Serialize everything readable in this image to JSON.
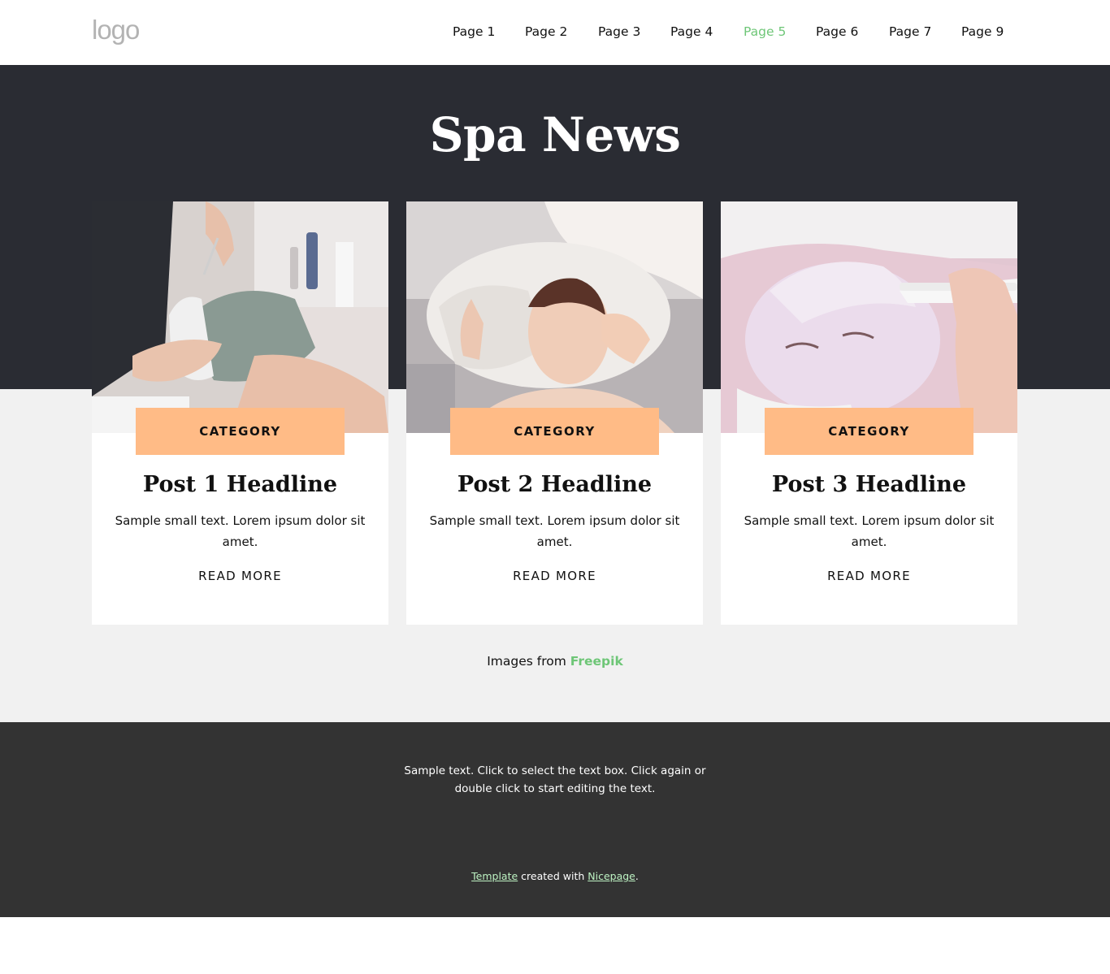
{
  "colors": {
    "accent": "#6ec677",
    "hero_background": "#2a2c33",
    "section_background": "#f1f1f1",
    "category_background": "#ffbb86",
    "footer_background": "#333333"
  },
  "header": {
    "logo": "logo",
    "nav": [
      {
        "label": "Page 1",
        "active": false
      },
      {
        "label": "Page 2",
        "active": false
      },
      {
        "label": "Page 3",
        "active": false
      },
      {
        "label": "Page 4",
        "active": false
      },
      {
        "label": "Page 5",
        "active": true
      },
      {
        "label": "Page 6",
        "active": false
      },
      {
        "label": "Page 7",
        "active": false
      },
      {
        "label": "Page 9",
        "active": false
      }
    ]
  },
  "hero": {
    "title": "Spa News"
  },
  "posts": [
    {
      "image": "spa-clay-mask-photo",
      "category": "CATEGORY",
      "title": "Post 1 Headline",
      "text": "Sample small text. Lorem ipsum dolor sit amet.",
      "link": "READ MORE"
    },
    {
      "image": "spa-facial-massage-photo",
      "category": "CATEGORY",
      "title": "Post 2 Headline",
      "text": "Sample small text. Lorem ipsum dolor sit amet.",
      "link": "READ MORE"
    },
    {
      "image": "spa-cream-mask-photo",
      "category": "CATEGORY",
      "title": "Post 3 Headline",
      "text": "Sample small text. Lorem ipsum dolor sit amet.",
      "link": "READ MORE"
    }
  ],
  "credit": {
    "prefix": "Images from",
    "link": "Freepik"
  },
  "footer": {
    "text": "Sample text. Click to select the text box. Click again or double click to start editing the text.",
    "template_link": "Template",
    "middle": "created with",
    "nicepage_link": "Nicepage",
    "suffix": "."
  }
}
